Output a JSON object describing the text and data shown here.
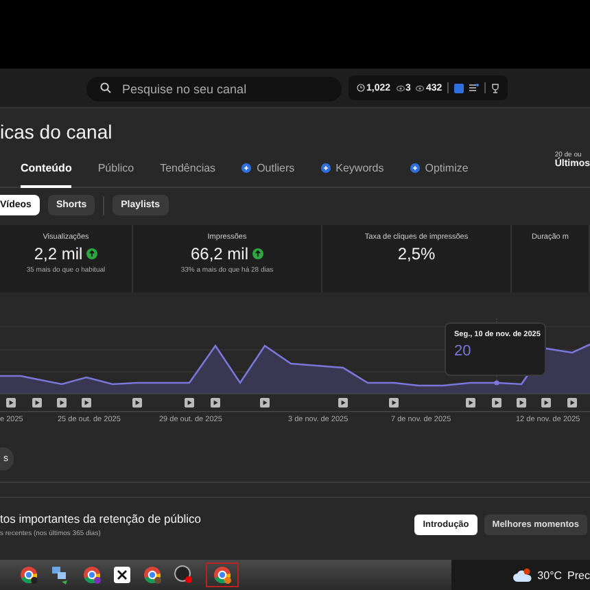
{
  "header": {
    "search": {
      "placeholder": "Pesquise no seu canal"
    },
    "stats": [
      "1,022",
      "3",
      "432"
    ]
  },
  "page_title": "icas do canal",
  "tabs": [
    {
      "label": "Conteúdo",
      "selected": true,
      "kind": "plain"
    },
    {
      "label": "Público",
      "selected": false,
      "kind": "plain"
    },
    {
      "label": "Tendências",
      "selected": false,
      "kind": "plain"
    },
    {
      "label": "Outliers",
      "selected": false,
      "kind": "addon"
    },
    {
      "label": "Keywords",
      "selected": false,
      "kind": "addon"
    },
    {
      "label": "Optimize",
      "selected": false,
      "kind": "addon"
    }
  ],
  "date_range": {
    "dates": "20 de ou",
    "label": "Últimos"
  },
  "chips": [
    {
      "label": "Vídeos",
      "selected": true
    },
    {
      "label": "Shorts",
      "selected": false
    },
    {
      "label": "Playlists",
      "selected": false
    }
  ],
  "metrics": [
    {
      "title": "Visualizações",
      "value": "2,2 mil",
      "trend_up": true,
      "note": "35 mais do que o habitual"
    },
    {
      "title": "Impressões",
      "value": "66,2 mil",
      "trend_up": true,
      "note": "33% a mais do que há 28 dias"
    },
    {
      "title": "Taxa de cliques de impressões",
      "value": "2,5%",
      "trend_up": false
    },
    {
      "title": "Duração m"
    }
  ],
  "chart": {
    "x_labels": [
      "e 2025",
      "25 de out. de 2025",
      "29 de out. de 2025",
      "3 de nov. de 2025",
      "7 de nov. de 2025",
      "12 de nov. de 2025"
    ],
    "tooltip": {
      "date": "Seg., 10 de nov. de 2025",
      "value": "20"
    }
  },
  "more_button": "s",
  "retention": {
    "title": "tos importantes da retenção de público",
    "subtitle": "s recentes (nos últimos 365 dias)",
    "buttons": [
      {
        "label": "Introdução",
        "selected": true
      },
      {
        "label": "Melhores momentos",
        "selected": false
      }
    ]
  },
  "taskbar": {
    "weather": "30°C",
    "weather_text": "Prec"
  }
}
